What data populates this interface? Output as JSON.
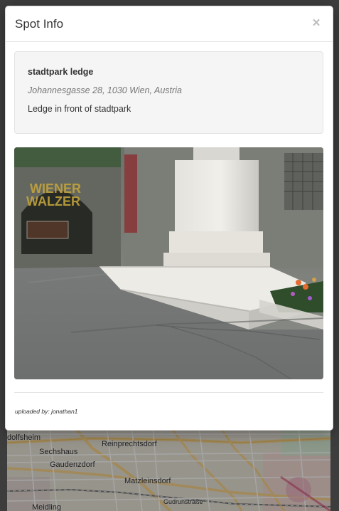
{
  "modal": {
    "title": "Spot Info",
    "close_glyph": "×",
    "close_icon": "close-icon"
  },
  "spot": {
    "name": "stadtpark ledge",
    "address": "Johannesgasse 28, 1030 Wien, Austria",
    "description": "Ledge in front of stadtpark"
  },
  "photo": {
    "sign_text_1": "WIENER",
    "sign_text_2": "WALZER"
  },
  "footer": {
    "uploaded_prefix": "uploaded by:",
    "uploader": "jonathan1"
  },
  "map": {
    "labels": [
      "dolfsheim",
      "Sechshaus",
      "Reinprechtsdorf",
      "Gaudenzdorf",
      "Matzleinsdorf",
      "Meidling",
      "Gudrunstraße"
    ]
  },
  "colors": {
    "modal_bg": "#ffffff",
    "well_bg": "#f5f5f5",
    "text": "#333333",
    "muted_text": "#777777",
    "close": "#bdbdbd",
    "map_bg": "#e9e4d6",
    "backdrop": "rgba(0,0,0,0.35)"
  }
}
